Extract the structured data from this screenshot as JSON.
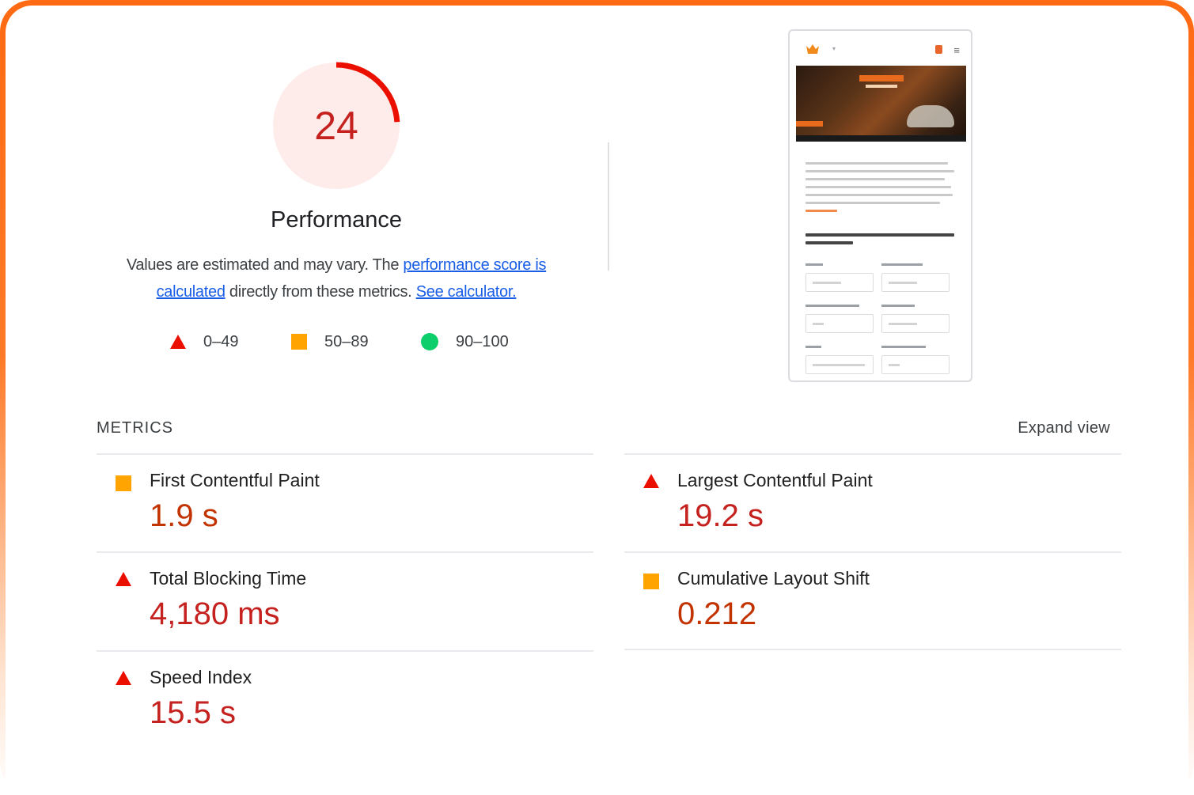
{
  "score": {
    "value": "24",
    "fraction": 0.24,
    "color": "#eb0f00",
    "bg_color": "#fdecea"
  },
  "performance": {
    "title": "Performance",
    "desc_prefix": "Values are estimated and may vary. The ",
    "link_score": "performance score is calculated",
    "desc_middle": " directly from these metrics. ",
    "link_calc": "See calculator."
  },
  "legend": {
    "fail": "0–49",
    "average": "50–89",
    "pass": "90–100"
  },
  "metrics": {
    "header": "METRICS",
    "expand": "Expand view",
    "items": [
      {
        "label": "First Contentful Paint",
        "value": "1.9 s",
        "rating": "average"
      },
      {
        "label": "Largest Contentful Paint",
        "value": "19.2 s",
        "rating": "fail"
      },
      {
        "label": "Total Blocking Time",
        "value": "4,180 ms",
        "rating": "fail"
      },
      {
        "label": "Cumulative Layout Shift",
        "value": "0.212",
        "rating": "average"
      },
      {
        "label": "Speed Index",
        "value": "15.5 s",
        "rating": "fail"
      }
    ]
  },
  "colors": {
    "fail": "#eb0f00",
    "average": "#ffa400",
    "pass": "#0cce6b",
    "frame": "#ff6a13",
    "link": "#1a5ee8"
  }
}
